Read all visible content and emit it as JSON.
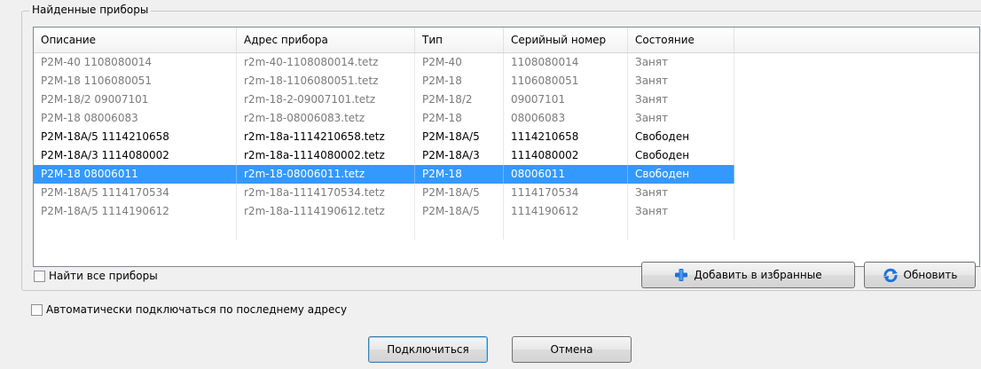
{
  "group": {
    "title": "Найденные приборы"
  },
  "table": {
    "columns": [
      "Описание",
      "Адрес прибора",
      "Тип",
      "Серийный номер",
      "Состояние"
    ],
    "rows": [
      {
        "description": "P2M-40 1108080014",
        "address": "r2m-40-1108080014.tetz",
        "type": "P2M-40",
        "serial": "1108080014",
        "state": "Занят",
        "status": "busy",
        "selected": false
      },
      {
        "description": "P2M-18 1106080051",
        "address": "r2m-18-1106080051.tetz",
        "type": "P2M-18",
        "serial": "1106080051",
        "state": "Занят",
        "status": "busy",
        "selected": false
      },
      {
        "description": "P2M-18/2 09007101",
        "address": "r2m-18-2-09007101.tetz",
        "type": "P2M-18/2",
        "serial": "09007101",
        "state": "Занят",
        "status": "busy",
        "selected": false
      },
      {
        "description": "P2M-18 08006083",
        "address": "r2m-18-08006083.tetz",
        "type": "P2M-18",
        "serial": "08006083",
        "state": "Занят",
        "status": "busy",
        "selected": false
      },
      {
        "description": "P2M-18A/5 1114210658",
        "address": "r2m-18a-1114210658.tetz",
        "type": "P2M-18A/5",
        "serial": "1114210658",
        "state": "Свободен",
        "status": "free",
        "selected": false
      },
      {
        "description": "P2M-18A/3 1114080002",
        "address": "r2m-18a-1114080002.tetz",
        "type": "P2M-18A/3",
        "serial": "1114080002",
        "state": "Свободен",
        "status": "free",
        "selected": false
      },
      {
        "description": "P2M-18 08006011",
        "address": "r2m-18-08006011.tetz",
        "type": "P2M-18",
        "serial": "08006011",
        "state": "Свободен",
        "status": "free",
        "selected": true
      },
      {
        "description": "P2M-18A/5 1114170534",
        "address": "r2m-18a-1114170534.tetz",
        "type": "P2M-18A/5",
        "serial": "1114170534",
        "state": "Занят",
        "status": "busy",
        "selected": false
      },
      {
        "description": "P2M-18A/5 1114190612",
        "address": "r2m-18a-1114190612.tetz",
        "type": "P2M-18A/5",
        "serial": "1114190612",
        "state": "Занят",
        "status": "busy",
        "selected": false
      }
    ]
  },
  "find_all": {
    "label": "Найти все приборы",
    "checked": false
  },
  "buttons": {
    "add_favorites": "Добавить в избранные",
    "refresh": "Обновить",
    "connect": "Подключиться",
    "cancel": "Отмена"
  },
  "auto_connect": {
    "label": "Автоматически подключаться по последнему адресу",
    "checked": false
  },
  "icons": {
    "add_favorites": "plus-icon",
    "refresh": "refresh-icon"
  },
  "colors": {
    "selection": "#3399ff",
    "busy_text": "#7a7a7a",
    "plus_icon": "#1e73d8"
  }
}
